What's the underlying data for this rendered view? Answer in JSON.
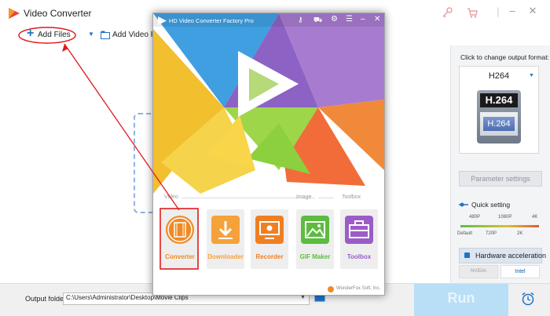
{
  "app": {
    "title": "Video Converter"
  },
  "toolbar": {
    "add_files_label": "Add Files",
    "add_folder_label": "Add Video Fol"
  },
  "right_panel": {
    "change_format_label": "Click to change output format:",
    "format_name": "H264",
    "format_badge_top": "H.264",
    "format_badge_bottom": "H.264",
    "parameter_settings_label": "Parameter settings",
    "quick_setting_label": "Quick setting",
    "quality_top_ticks": [
      "480P",
      "1080P",
      "4K"
    ],
    "quality_bottom_ticks": [
      "Default",
      "720P",
      "2K"
    ],
    "hardware_acceleration_label": "Hardware acceleration",
    "nvidia_label": "NVIDIA",
    "intel_label": "Intel"
  },
  "bottom_bar": {
    "output_folder_label": "Output folder:",
    "output_folder_value": "C:\\Users\\Administrator\\Desktop\\Movie Clips",
    "run_label": "Run"
  },
  "popup": {
    "title": "HD Video Converter Factory Pro",
    "section_video": "Video",
    "section_image": "Image",
    "section_toolbox": "Toolbox",
    "tiles": [
      {
        "label": "Converter",
        "icon": "film-reel-icon"
      },
      {
        "label": "Downloader",
        "icon": "download-arrow-icon"
      },
      {
        "label": "Recorder",
        "icon": "screen-recorder-icon"
      },
      {
        "label": "GIF Maker",
        "icon": "image-landscape-icon"
      },
      {
        "label": "Toolbox",
        "icon": "toolbox-icon"
      }
    ],
    "footer": "WonderFox Soft, Inc.",
    "colors": {
      "converter": "#f08a24",
      "downloader": "#f5a23a",
      "recorder": "#f07f22",
      "gif_maker": "#5dbb3f",
      "toolbox": "#9b5cc7",
      "annotation": "#e01b1b",
      "accent_blue": "#1e73c8"
    }
  }
}
